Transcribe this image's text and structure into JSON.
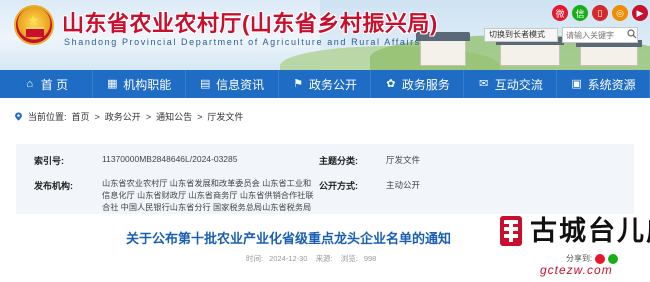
{
  "header": {
    "title": "山东省农业农村厅(山东省乡村振兴局)",
    "subtitle": "Shandong Provincial Department of Agriculture and Rural Affairs",
    "switch_label": "切换到长者模式",
    "search_placeholder": "请输入关键字",
    "social_icons": [
      "weibo-icon",
      "wechat-icon",
      "mobile-icon",
      "app-icon",
      "video-icon"
    ]
  },
  "nav": {
    "items": [
      {
        "label": "首 页",
        "icon": "home-icon"
      },
      {
        "label": "机构职能",
        "icon": "building-icon"
      },
      {
        "label": "信息资讯",
        "icon": "news-icon"
      },
      {
        "label": "政务公开",
        "icon": "flag-icon"
      },
      {
        "label": "政务服务",
        "icon": "service-icon"
      },
      {
        "label": "互动交流",
        "icon": "chat-icon"
      },
      {
        "label": "系统资源",
        "icon": "system-icon"
      }
    ]
  },
  "breadcrumb": {
    "prefix": "当前位置:",
    "items": [
      "首页",
      "政务公开",
      "通知公告",
      "厅发文件"
    ],
    "separator": ">"
  },
  "info": {
    "index_label": "索引号:",
    "index_value": "11370000MB2848646L/2024-03285",
    "category_label": "主题分类:",
    "category_value": "厅发文件",
    "publisher_label": "发布机构:",
    "publisher_value": "山东省农业农村厅 山东省发展和改革委员会 山东省工业和信息化厅 山东省财政厅 山东省商务厅 山东省供销合作社联合社 中国人民银行山东省分行 国家税务总局山东省税务局",
    "open_label": "公开方式:",
    "open_value": "主动公开"
  },
  "article": {
    "title": "关于公布第十批农业产业化省级重点龙头企业名单的通知",
    "date_label": "时间:",
    "date": "2024-12-30",
    "source_label": "来源:",
    "source": "",
    "views_label": "浏览:",
    "views": "998",
    "share_label": "分享到:"
  },
  "watermark": {
    "brand": "古城台儿庄",
    "url": "gctezw.com"
  },
  "colors": {
    "nav": "#1f6cc4",
    "title_red": "#c8102e",
    "link_blue": "#1a5fb4",
    "info_bg": "#f2f6fb"
  }
}
